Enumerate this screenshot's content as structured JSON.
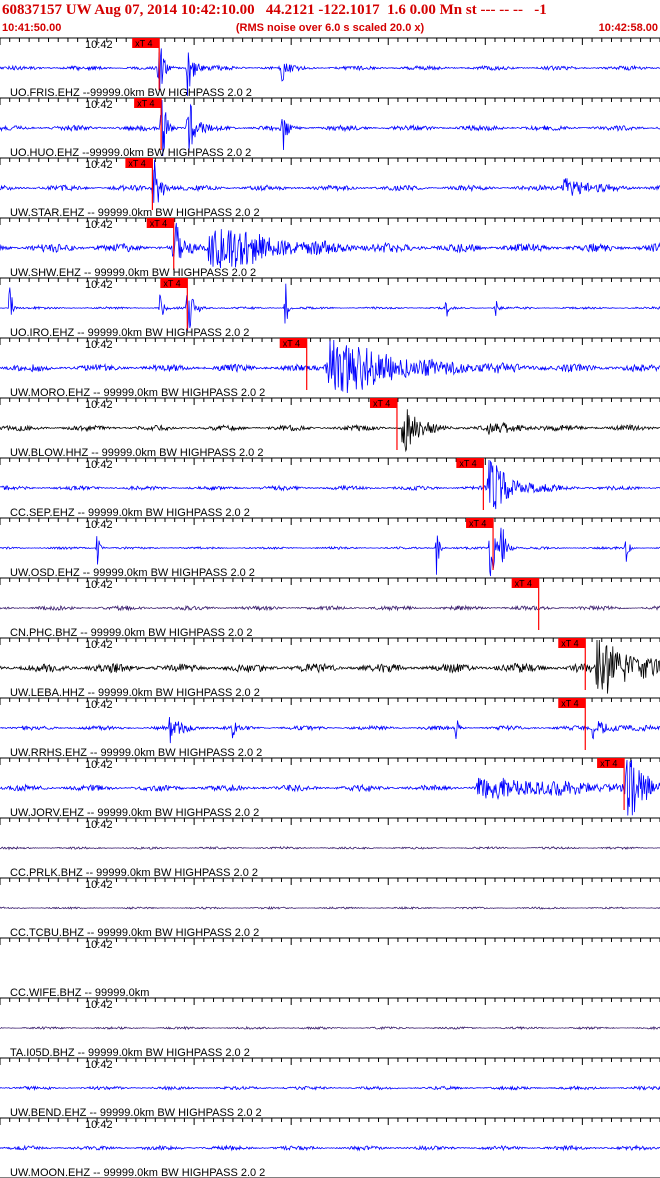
{
  "header": {
    "title": "60837157 UW Aug 07, 2014 10:42:10.00   44.2121 -122.1017  1.6 0.00 Mn st --- -- --   -1",
    "start_time": "10:41:50.00",
    "note": "(RMS noise over 6.0 s scaled 20.0 x)",
    "end_time": "10:42:58.00"
  },
  "colors": {
    "header": "#d40000",
    "blue_trace": "#0000ff",
    "black_trace": "#000000",
    "purple_trace": "#3b1f6e",
    "pick_box": "#ff0000"
  },
  "chart_data": {
    "type": "line",
    "x_range_seconds": [
      0,
      68
    ],
    "x_start": "10:41:50.00",
    "x_end": "10:42:58.00",
    "tick_interval_seconds": 1,
    "minute_marker": {
      "label": "10:42",
      "seconds": 10
    },
    "series": [
      {
        "label": "UO.FRIS.EHZ --99999.0km BW  HIGHPASS  2.0  2",
        "pick_label": "xT 4",
        "pick_seconds": 16.4,
        "color": "blue",
        "noise": 0.22,
        "events": [
          {
            "t": 16.3,
            "amp": 5,
            "dur": 0.35
          },
          {
            "t": 19.3,
            "amp": 3.5,
            "dur": 0.5
          },
          {
            "t": 29,
            "amp": 1.4,
            "dur": 0.6
          }
        ]
      },
      {
        "label": "UO.HUO.EHZ --99999.0km BW  HIGHPASS  2.0  2",
        "pick_label": "xT 4",
        "pick_seconds": 16.6,
        "color": "blue",
        "noise": 0.28,
        "events": [
          {
            "t": 16.6,
            "amp": 5,
            "dur": 0.4
          },
          {
            "t": 19.3,
            "amp": 4,
            "dur": 0.6
          },
          {
            "t": 29.1,
            "amp": 3,
            "dur": 0.3
          }
        ]
      },
      {
        "label": "UW.STAR.EHZ -- 99999.0km BW  HIGHPASS  2.0  2",
        "pick_label": "xT 4",
        "pick_seconds": 15.7,
        "color": "blue",
        "noise": 0.28,
        "events": [
          {
            "t": 15.8,
            "amp": 4,
            "dur": 0.6
          },
          {
            "t": 58,
            "amp": 1.2,
            "dur": 2
          }
        ]
      },
      {
        "label": "UW.SHW.EHZ -- 99999.0km BW  HIGHPASS  2.0  2",
        "pick_label": "xT 4",
        "pick_seconds": 17.9,
        "color": "blue",
        "noise": 0.45,
        "events": [
          {
            "t": 17.9,
            "amp": 4,
            "dur": 0.5
          },
          {
            "t": 21.5,
            "amp": 3,
            "dur": 5
          }
        ]
      },
      {
        "label": "UO.IRO.EHZ -- 99999.0km BW  HIGHPASS  2.0  2",
        "pick_label": "xT 4",
        "pick_seconds": 19.3,
        "color": "blue",
        "noise": 0.12,
        "events": [
          {
            "t": 1,
            "amp": 3.5,
            "dur": 0.2
          },
          {
            "t": 16.5,
            "amp": 3,
            "dur": 0.2
          },
          {
            "t": 19.3,
            "amp": 4.5,
            "dur": 0.5
          },
          {
            "t": 29.4,
            "amp": 3,
            "dur": 0.2
          },
          {
            "t": 46,
            "amp": 1.5,
            "dur": 0.2
          },
          {
            "t": 51,
            "amp": 1.5,
            "dur": 0.2
          }
        ]
      },
      {
        "label": "UW.MORO.EHZ -- 99999.0km BW  HIGHPASS  2.0  2",
        "pick_label": "xT 4",
        "pick_seconds": 31.6,
        "color": "blue",
        "noise": 0.38,
        "events": [
          {
            "t": 33.5,
            "amp": 3.5,
            "dur": 6
          }
        ]
      },
      {
        "label": "UW.BLOW.HHZ -- 99999.0km BW  HIGHPASS  2.0  2",
        "pick_label": "xT 4",
        "pick_seconds": 40.9,
        "color": "black",
        "noise": 0.28,
        "events": [
          {
            "t": 41.5,
            "amp": 3,
            "dur": 1.2
          },
          {
            "t": 50,
            "amp": 0.6,
            "dur": 3
          }
        ]
      },
      {
        "label": "CC.SEP.EHZ -- 99999.0km BW  HIGHPASS  2.0  2",
        "pick_label": "xT 4",
        "pick_seconds": 49.8,
        "color": "blue",
        "noise": 0.22,
        "events": [
          {
            "t": 50.3,
            "amp": 3.5,
            "dur": 2
          }
        ]
      },
      {
        "label": "UW.OSD.EHZ -- 99999.0km BW  HIGHPASS  2.0  2",
        "pick_label": "xT 4",
        "pick_seconds": 50.8,
        "color": "blue",
        "noise": 0.12,
        "events": [
          {
            "t": 10,
            "amp": 2.2,
            "dur": 0.2
          },
          {
            "t": 45,
            "amp": 3.5,
            "dur": 0.2
          },
          {
            "t": 50.5,
            "amp": 4.5,
            "dur": 0.4
          },
          {
            "t": 51.6,
            "amp": 3.5,
            "dur": 0.4
          },
          {
            "t": 64.5,
            "amp": 2.5,
            "dur": 0.2
          }
        ]
      },
      {
        "label": "CN.PHC.BHZ -- 99999.0km BW  HIGHPASS  2.0  2",
        "pick_label": "xT 4",
        "pick_seconds": 55.5,
        "color": "purple",
        "noise": 0.22,
        "events": []
      },
      {
        "label": "UW.LEBA.HHZ -- 99999.0km BW  HIGHPASS  2.0  2",
        "pick_label": "xT 4",
        "pick_seconds": 60.3,
        "color": "black",
        "noise": 0.48,
        "events": [
          {
            "t": 61.5,
            "amp": 3.5,
            "dur": 3
          }
        ]
      },
      {
        "label": "UW.RRHS.EHZ -- 99999.0km BW  HIGHPASS  2.0  2",
        "pick_label": "xT 4",
        "pick_seconds": 60.3,
        "color": "blue",
        "noise": 0.22,
        "events": [
          {
            "t": 17.5,
            "amp": 1.6,
            "dur": 1
          },
          {
            "t": 24,
            "amp": 1.5,
            "dur": 0.2
          },
          {
            "t": 47,
            "amp": 1.4,
            "dur": 0.2
          },
          {
            "t": 61,
            "amp": 1,
            "dur": 2
          }
        ]
      },
      {
        "label": "UW.JORV.EHZ -- 99999.0km BW  HIGHPASS  2.0  2",
        "pick_label": "xT 4",
        "pick_seconds": 64.3,
        "color": "blue",
        "noise": 0.32,
        "events": [
          {
            "t": 49,
            "amp": 0.9,
            "dur": 14
          },
          {
            "t": 64.5,
            "amp": 3.5,
            "dur": 1.5
          }
        ]
      },
      {
        "label": "CC.PRLK.BHZ -- 99999.0km BW  HIGHPASS  2.0  2",
        "pick_label": "",
        "pick_seconds": null,
        "color": "purple",
        "noise": 0.12,
        "events": []
      },
      {
        "label": "CC.TCBU.BHZ -- 99999.0km BW  HIGHPASS  2.0  2",
        "pick_label": "",
        "pick_seconds": null,
        "color": "purple",
        "noise": 0.1,
        "events": []
      },
      {
        "label": "CC.WIFE.BHZ -- 99999.0km",
        "pick_label": "",
        "pick_seconds": null,
        "color": "none",
        "noise": 0,
        "events": []
      },
      {
        "label": "TA.I05D.BHZ -- 99999.0km BW  HIGHPASS  2.0  2",
        "pick_label": "",
        "pick_seconds": null,
        "color": "purple",
        "noise": 0.12,
        "events": []
      },
      {
        "label": "UW.BEND.EHZ -- 99999.0km BW  HIGHPASS  2.0  2",
        "pick_label": "",
        "pick_seconds": null,
        "color": "blue",
        "noise": 0.18,
        "events": []
      },
      {
        "label": "UW.MOON.EHZ -- 99999.0km BW  HIGHPASS  2.0  2",
        "pick_label": "",
        "pick_seconds": null,
        "color": "blue",
        "noise": 0.22,
        "events": []
      }
    ]
  }
}
